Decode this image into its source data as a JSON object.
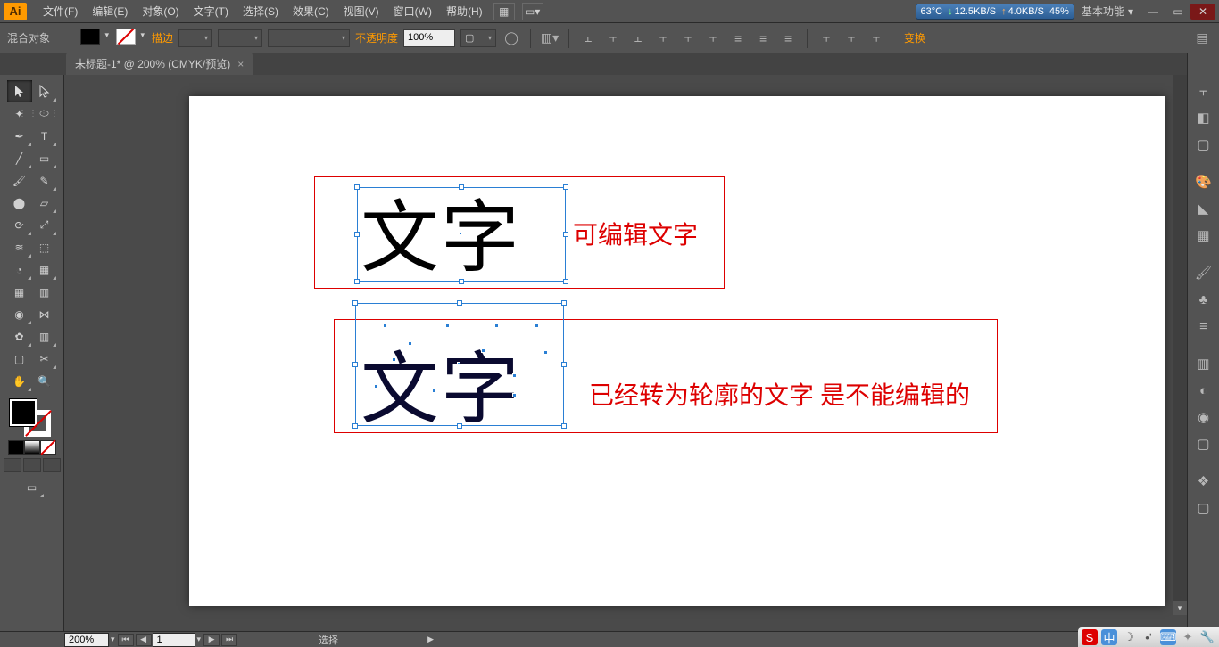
{
  "app": {
    "logo": "Ai"
  },
  "menu": [
    "文件(F)",
    "编辑(E)",
    "对象(O)",
    "文字(T)",
    "选择(S)",
    "效果(C)",
    "视图(V)",
    "窗口(W)",
    "帮助(H)"
  ],
  "sysmon": {
    "temp": "63°C",
    "down": "12.5KB/S",
    "up": "4.0KB/S",
    "pct": "45%"
  },
  "workspace": "基本功能",
  "options": {
    "context": "混合对象",
    "stroke_label": "描边",
    "opacity_label": "不透明度",
    "opacity_value": "100%",
    "transform_label": "变换"
  },
  "tab": {
    "title": "未标题-1* @ 200% (CMYK/预览)"
  },
  "canvas": {
    "text_sample": "文字",
    "label_editable": "可编辑文字",
    "label_outlined": "已经转为轮廓的文字 是不能编辑的"
  },
  "status": {
    "zoom": "200%",
    "artboard": "1",
    "tool": "选择"
  },
  "icons": {
    "minimize": "—",
    "maximize": "▭",
    "close": "✕",
    "selection": "▲",
    "direct": "▷",
    "wand": "✦",
    "lasso": "◯",
    "pen": "✒",
    "type": "T",
    "line": "╱",
    "rect": "▭",
    "brush": "🖌",
    "pencil": "✎",
    "blob": "⬤",
    "eraser": "▱",
    "rotate": "⟳",
    "scale": "⤢",
    "width": "≋",
    "warp": "⬭",
    "shapebuilder": "◔",
    "perspective": "▦",
    "mesh": "▦",
    "gradient": "▥",
    "eyedrop": "◉",
    "blend": "⋈",
    "symbol": "✿",
    "graph": "▥",
    "artboard": "▢",
    "slice": "✂",
    "hand": "✋",
    "zoom": "🔍",
    "chev": "▾",
    "menu": "▤"
  }
}
